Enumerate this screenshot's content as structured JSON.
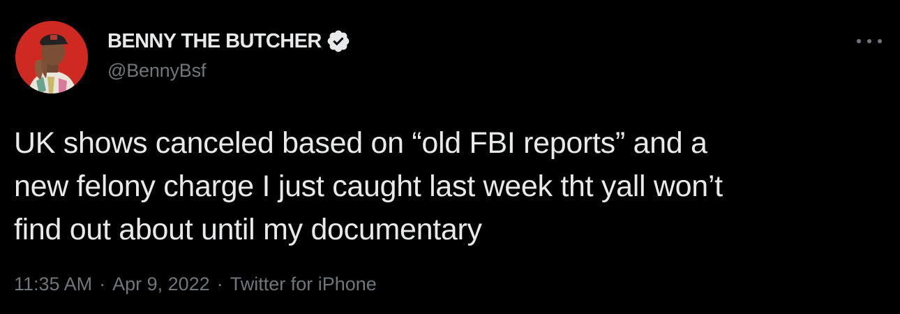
{
  "user": {
    "display_name": "BENNY THE BUTCHER",
    "handle": "@BennyBsf",
    "verified": true
  },
  "tweet": {
    "text": "UK shows canceled based on “old FBI reports” and a\nnew felony charge I just caught last week tht yall won’t\nfind out about until my documentary"
  },
  "meta": {
    "time": "11:35 AM",
    "date": "Apr 9, 2022",
    "source": "Twitter for iPhone",
    "separator": "·"
  },
  "icons": {
    "more": "more-horizontal-icon",
    "verified": "verified-badge-icon"
  },
  "colors": {
    "background": "#000000",
    "primary_text": "#e7e9ea",
    "secondary_text": "#71767b",
    "avatar_bg": "#d12a22"
  }
}
